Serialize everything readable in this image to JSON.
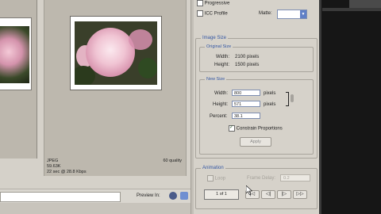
{
  "preview": {
    "format": "JPEG",
    "size": "59.63K",
    "time": "22 sec @ 28.8 Kbps",
    "quality": "60 quality",
    "status_label": "Preview In:"
  },
  "options": {
    "progressive_label": "Progressive",
    "progressive_checked": false,
    "icc_label": "ICC Profile",
    "icc_checked": false,
    "matte_label": "Matte:",
    "matte_value": ""
  },
  "image_size": {
    "title": "Image Size",
    "original": {
      "title": "Original Size",
      "width_label": "Width:",
      "width_value": "2100 pixels",
      "height_label": "Height:",
      "height_value": "1500 pixels"
    },
    "new": {
      "title": "New Size",
      "width_label": "Width:",
      "width_value": "800",
      "height_label": "Height:",
      "height_value": "571",
      "percent_label": "Percent:",
      "percent_value": "38.1",
      "unit": "pixels",
      "constrain_label": "Constrain Proportions",
      "constrain_checked": true,
      "apply_label": "Apply"
    }
  },
  "animation": {
    "title": "Animation",
    "loop_label": "Loop",
    "frame_delay_label": "Frame Delay:",
    "frame_delay_value": "0.2",
    "frame_counter": "1 of 1",
    "buttons": [
      "|◁",
      "◁|",
      "|▷",
      "▷▷"
    ]
  },
  "colors": {
    "accent": "#3457a3",
    "panel_bg": "#d6d2ca",
    "dark_bg": "#161616"
  }
}
